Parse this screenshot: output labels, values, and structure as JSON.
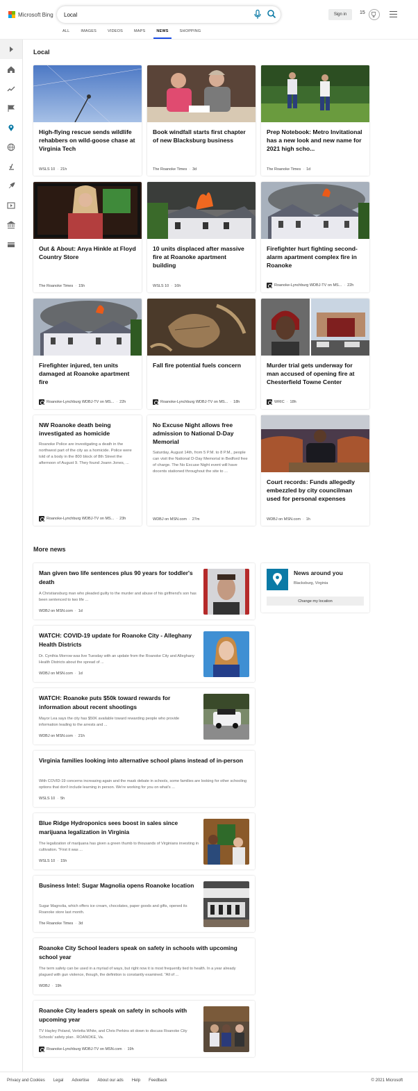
{
  "header": {
    "logo_text": "Microsoft Bing",
    "search_value": "Local",
    "signin_label": "Sign in",
    "points": "15",
    "tabs": [
      "ALL",
      "IMAGES",
      "VIDEOS",
      "MAPS",
      "NEWS",
      "SHOPPING"
    ],
    "active_tab": "NEWS"
  },
  "local": {
    "title": "Local",
    "cards": [
      {
        "title": "High-flying rescue sends wildlife rehabbers on wild-goose chase at Virginia Tech",
        "source": "WSLS 10",
        "time": "21h",
        "snippet": "",
        "image": "sky-crane"
      },
      {
        "title": "Book windfall starts first chapter of new Blacksburg business",
        "source": "The Roanoke Times",
        "time": "3d",
        "snippet": "",
        "image": "two-women"
      },
      {
        "title": "Prep Notebook: Metro Invitational has a new look and new name for 2021 high scho...",
        "source": "The Roanoke Times",
        "time": "1d",
        "snippet": "",
        "image": "golfers"
      },
      {
        "title": "Out & About: Anya Hinkle at Floyd Country Store",
        "source": "The Roanoke Times",
        "time": "15h",
        "snippet": "",
        "image": "singer"
      },
      {
        "title": "10 units displaced after massive fire at Roanoke apartment building",
        "source": "WSLS 10",
        "time": "16h",
        "snippet": "",
        "image": "fire-building"
      },
      {
        "title": "Firefighter hurt fighting second-alarm apartment complex fire in Roanoke",
        "source": "Roanoke-Lynchburg WDBJ-TV on MS...",
        "time": "22h",
        "snippet": "",
        "image": "fire-smoke",
        "pub_icon": true
      },
      {
        "title": "Firefighter injured, ten units damaged at Roanoke apartment fire",
        "source": "Roanoke-Lynchburg WDBJ-TV on MS...",
        "time": "22h",
        "snippet": "",
        "image": "fire-smoke",
        "pub_icon": true
      },
      {
        "title": "Fall fire potential fuels concern",
        "source": "Roanoke-Lynchburg WDBJ-TV on MS...",
        "time": "18h",
        "snippet": "",
        "image": "leaves",
        "pub_icon": true
      },
      {
        "title": "Murder trial gets underway for man accused of opening fire at Chesterfield Towne Center",
        "source": "WRIC",
        "time": "18h",
        "snippet": "",
        "image": "mugshot-mall",
        "pub_icon": true
      },
      {
        "title": "NW Roanoke death being investigated as homicide",
        "source": "Roanoke-Lynchburg WDBJ-TV on MS...",
        "time": "23h",
        "snippet": "Roanoke Police are investigating a death in the northwest part of the city as a homicide. Police were told of a body in the 800 block of 8th Street the afternoon of August 9. They found Joann Jones, ...",
        "image": "",
        "pub_icon": true
      },
      {
        "title": "No Excuse Night allows free admission to National D-Day Memorial",
        "source": "WDBJ on MSN.com",
        "time": "27m",
        "snippet": "Saturday, August 14th, from 5 P.M. to 8 P.M., people can visit the National D-Day Memorial in Bedford free of charge. The No Excuse Night event will have docents stationed throughout the site to ...",
        "image": ""
      },
      {
        "title": "Court records: Funds allegedly embezzled by city councilman used for personal expenses",
        "source": "WDBJ on MSN.com",
        "time": "1h",
        "snippet": "",
        "image": "council"
      }
    ]
  },
  "more_news": {
    "title": "More news",
    "items": [
      {
        "title": "Man given two life sentences plus 90 years for toddler's death",
        "snippet": "A Christiansburg man who pleaded guilty to the murder and abuse of his girlfriend's son has been sentenced to two life ...",
        "source": "WDBJ on MSN.com",
        "time": "1d",
        "thumb": "mugshot"
      },
      {
        "title": "WATCH: COVID-19 update for Roanoke City - Alleghany Health Districts",
        "snippet": "Dr. Cynthia Morrow was live Tuesday with an update from the Roanoke City and Alleghany Health Districts about the spread of ...",
        "source": "WDBJ on MSN.com",
        "time": "1d",
        "thumb": "doctor"
      },
      {
        "title": "WATCH: Roanoke puts $50k toward rewards for information about recent shootings",
        "snippet": "Mayor Lea says the city has $50K available toward rewarding people who provide information leading to the arrests and ...",
        "source": "WDBJ on MSN.com",
        "time": "21h",
        "thumb": "police"
      },
      {
        "title": "Virginia families looking into alternative school plans instead of in-person",
        "snippet": "With COVID-19 concerns increasing again and the mask debate in schools, some families are looking for other schooling options that don't include learning in person. We're working for you on what's ...",
        "source": "WSLS 10",
        "time": "5h",
        "thumb": ""
      },
      {
        "title": "Blue Ridge Hydroponics sees boost in sales since marijuana legalization in Virginia",
        "snippet": "The legalization of marijuana has given a green thumb to thousands of Virginians investing in cultivation. \"First it was ...",
        "source": "WSLS 10",
        "time": "15h",
        "thumb": "store"
      },
      {
        "title": "Business Intel: Sugar Magnolia opens Roanoke location",
        "snippet": "Sugar Magnolia, which offers ice cream, chocolates, paper goods and gifts, opened its Roanoke store last month.",
        "source": "The Roanoke Times",
        "time": "3d",
        "thumb": "shop"
      },
      {
        "title": "Roanoke City School leaders speak on safety in schools with upcoming school year",
        "snippet": "The term safety can be used in a myriad of ways, but right now it is most frequently tied to health. In a year already plagued with gun violence, though, the definition is constantly examined. \"All of ...",
        "source": "WDBJ",
        "time": "19h",
        "thumb": ""
      },
      {
        "title": "Roanoke City leaders speak on safety in schools with upcoming year",
        "snippet": "TV Hayley Poland, Verletta White, and Chris Perkins sit down to discuss Roanoke City Schools' safety plan . ROANOKE, Va.",
        "source": "Roanoke-Lynchburg WDBJ-TV on MSN.com",
        "time": "19h",
        "thumb": "library",
        "pub_icon": true
      }
    ]
  },
  "around": {
    "title": "News around you",
    "location": "Blacksburg, Virginia",
    "button": "Change my location"
  },
  "footer": {
    "links": [
      "Privacy and Cookies",
      "Legal",
      "Advertise",
      "About our ads",
      "Help",
      "Feedback"
    ],
    "copyright": "© 2021 Microsoft"
  },
  "colors": {
    "accent": "#174ae4",
    "teal": "#0b7aa6"
  },
  "sidebar_icons": [
    "expand-icon",
    "home-icon",
    "trending-icon",
    "flag-icon",
    "location-icon",
    "globe-icon",
    "science-icon",
    "rocket-icon",
    "video-icon",
    "bank-icon",
    "card-icon"
  ]
}
